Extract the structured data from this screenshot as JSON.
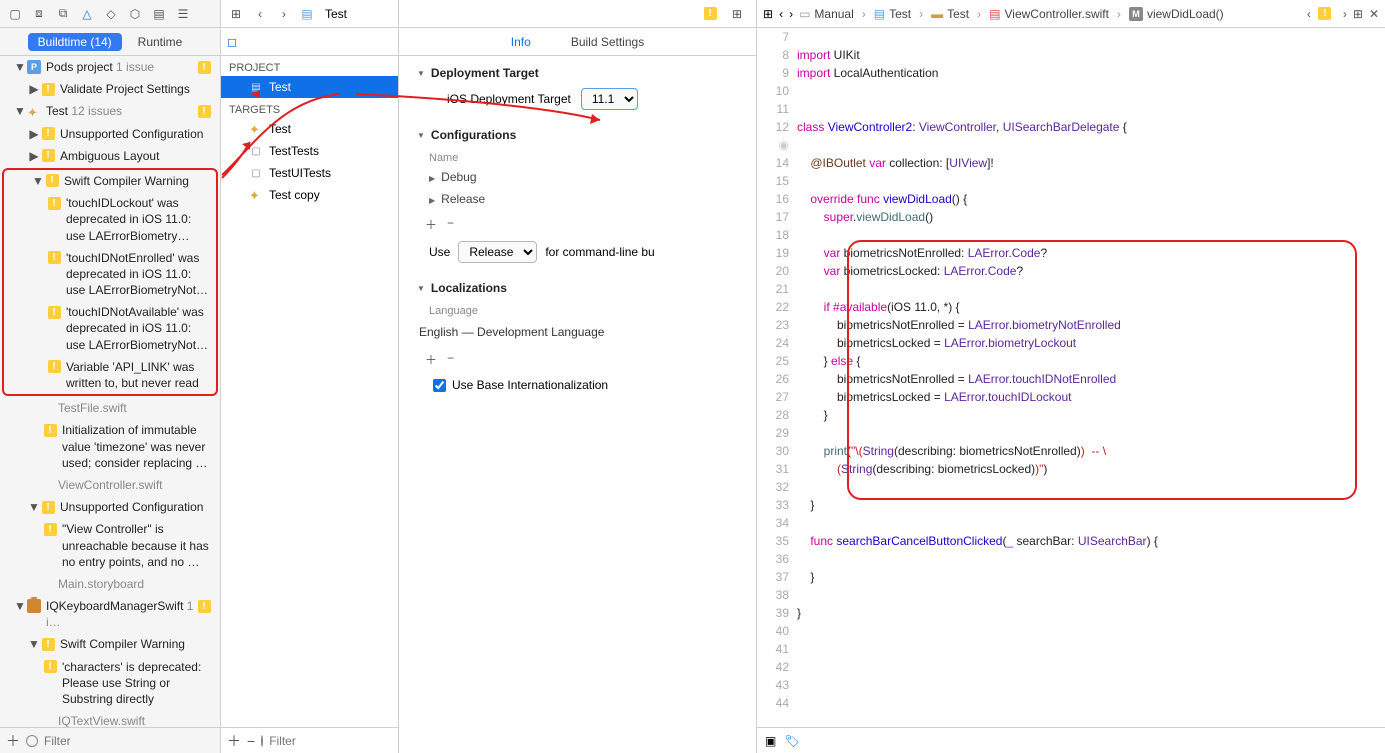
{
  "left": {
    "tabs": {
      "buildtime": "Buildtime (14)",
      "runtime": "Runtime"
    },
    "filter_placeholder": "Filter",
    "tree": {
      "pods_project": "Pods project",
      "pods_count": "1 issue",
      "validate": "Validate Project Settings",
      "test_proj": "Test",
      "test_count": "12 issues",
      "unsupported": "Unsupported Configuration",
      "ambiguous": "Ambiguous Layout",
      "swiftwarn": "Swift Compiler Warning",
      "w1": "'touchIDLockout' was deprecated in iOS 11.0: use LAErrorBiometry…",
      "w2": "'touchIDNotEnrolled' was deprecated in iOS 11.0: use LAErrorBiometryNot…",
      "w3": "'touchIDNotAvailable' was deprecated in iOS 11.0: use LAErrorBiometryNot…",
      "w4": "Variable 'API_LINK' was written to, but never read",
      "w4file": "TestFile.swift",
      "w5": "Initialization of immutable value 'timezone' was never used; consider replacing …",
      "w5file": "ViewController.swift",
      "unsupported2": "Unsupported Configuration",
      "w6": "\"View Controller\" is unreachable because it has no entry points, and no …",
      "w6file": "Main.storyboard",
      "iqkb": "IQKeyboardManagerSwift",
      "iqkb_count": "1 i…",
      "swiftwarn2": "Swift Compiler Warning",
      "w7": "'characters' is deprecated: Please use String or Substring directly",
      "w7file": "IQTextView.swift"
    }
  },
  "mid": {
    "crumb": "Test",
    "project_header": "PROJECT",
    "targets_header": "TARGETS",
    "project_item": "Test",
    "targets": [
      "Test",
      "TestTests",
      "TestUITests",
      "Test copy"
    ],
    "filter_placeholder": "Filter",
    "tabs": {
      "info": "Info",
      "build": "Build Settings"
    },
    "sections": {
      "deploy_title": "Deployment Target",
      "deploy_label": "iOS Deployment Target",
      "deploy_value": "11.1",
      "config_title": "Configurations",
      "config_name": "Name",
      "config_items": [
        "Debug",
        "Release"
      ],
      "cmd_use": "Use",
      "cmd_release": "Release",
      "cmd_tail": "for command-line bu",
      "loc_title": "Localizations",
      "loc_lang": "Language",
      "loc_value": "English — Development Language",
      "chk_label": "Use Base Internationalization"
    }
  },
  "right": {
    "crumb": {
      "manual": "Manual",
      "t1": "Test",
      "t2": "Test",
      "vc": "ViewController.swift",
      "m": "viewDidLoad()"
    },
    "lines_start": 7,
    "lines_end": 44
  }
}
